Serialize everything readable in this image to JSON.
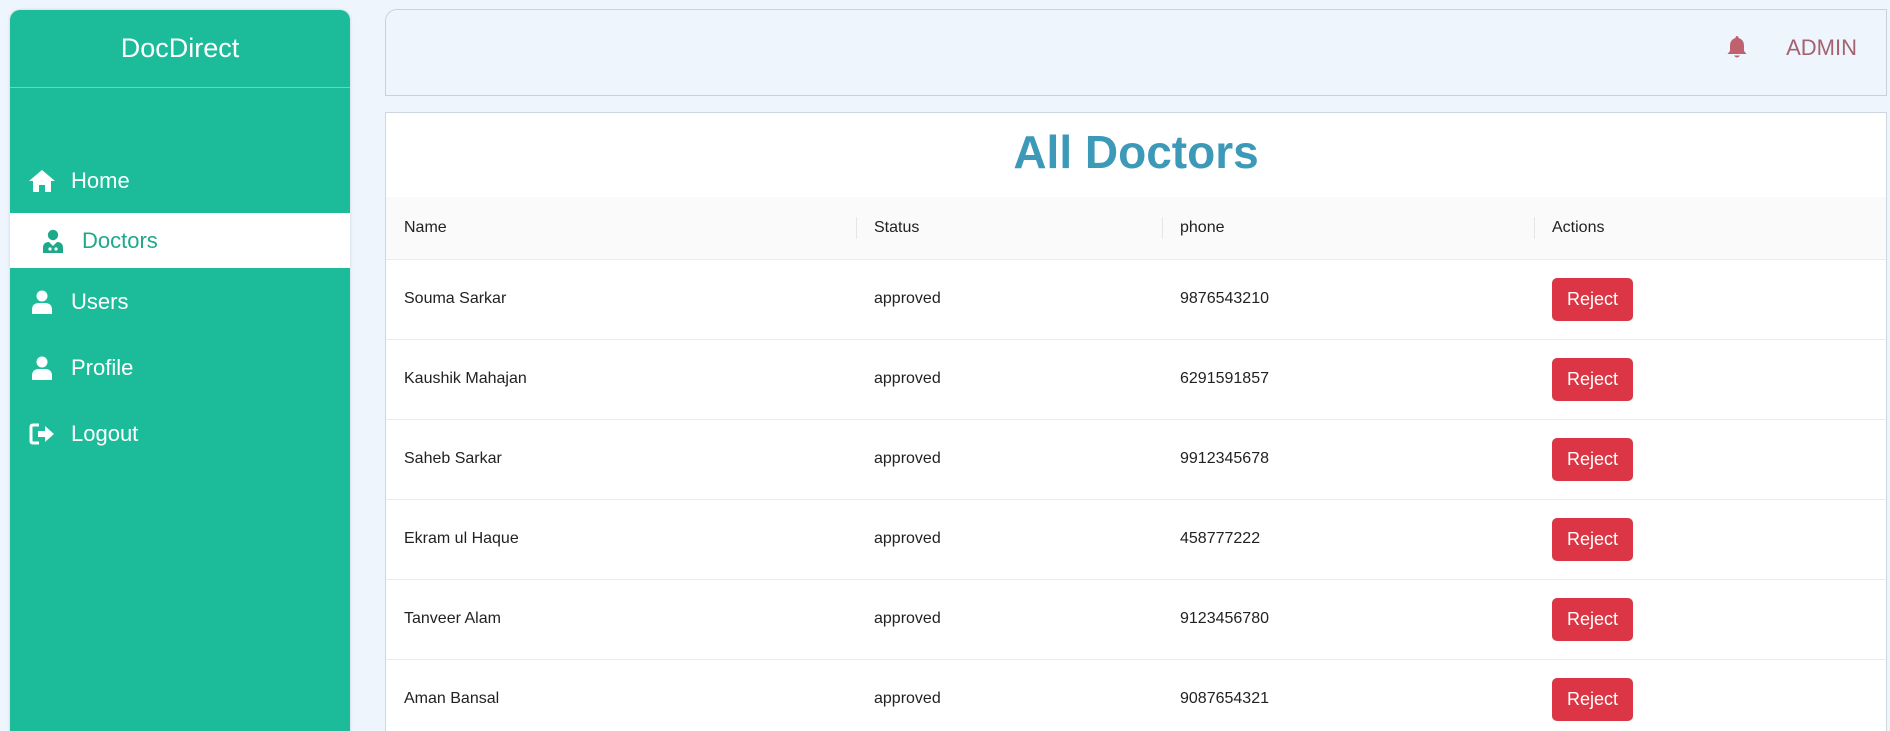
{
  "sidebar": {
    "brand": "DocDirect",
    "items": [
      {
        "label": "Home",
        "icon": "home-icon",
        "active": false
      },
      {
        "label": "Doctors",
        "icon": "doctor-icon",
        "active": true
      },
      {
        "label": "Users",
        "icon": "user-icon",
        "active": false
      },
      {
        "label": "Profile",
        "icon": "user-icon",
        "active": false
      },
      {
        "label": "Logout",
        "icon": "logout-icon",
        "active": false
      }
    ]
  },
  "header": {
    "notification_icon": "bell-icon",
    "user_label": "ADMIN"
  },
  "main": {
    "title": "All Doctors",
    "columns": [
      "Name",
      "Status",
      "phone",
      "Actions"
    ],
    "rows": [
      {
        "name": "Souma Sarkar",
        "status": "approved",
        "phone": "9876543210",
        "action": "Reject"
      },
      {
        "name": "Kaushik Mahajan",
        "status": "approved",
        "phone": "6291591857",
        "action": "Reject"
      },
      {
        "name": "Saheb Sarkar",
        "status": "approved",
        "phone": "9912345678",
        "action": "Reject"
      },
      {
        "name": "Ekram ul Haque",
        "status": "approved",
        "phone": "458777222",
        "action": "Reject"
      },
      {
        "name": "Tanveer Alam",
        "status": "approved",
        "phone": "9123456780",
        "action": "Reject"
      },
      {
        "name": "Aman Bansal",
        "status": "approved",
        "phone": "9087654321",
        "action": "Reject"
      }
    ]
  },
  "colors": {
    "sidebar": "#1cbc9b",
    "active_text": "#1ea98b",
    "title": "#3c9ab8",
    "reject": "#dc3545",
    "admin": "#a4636f",
    "bell": "#c0616f"
  }
}
